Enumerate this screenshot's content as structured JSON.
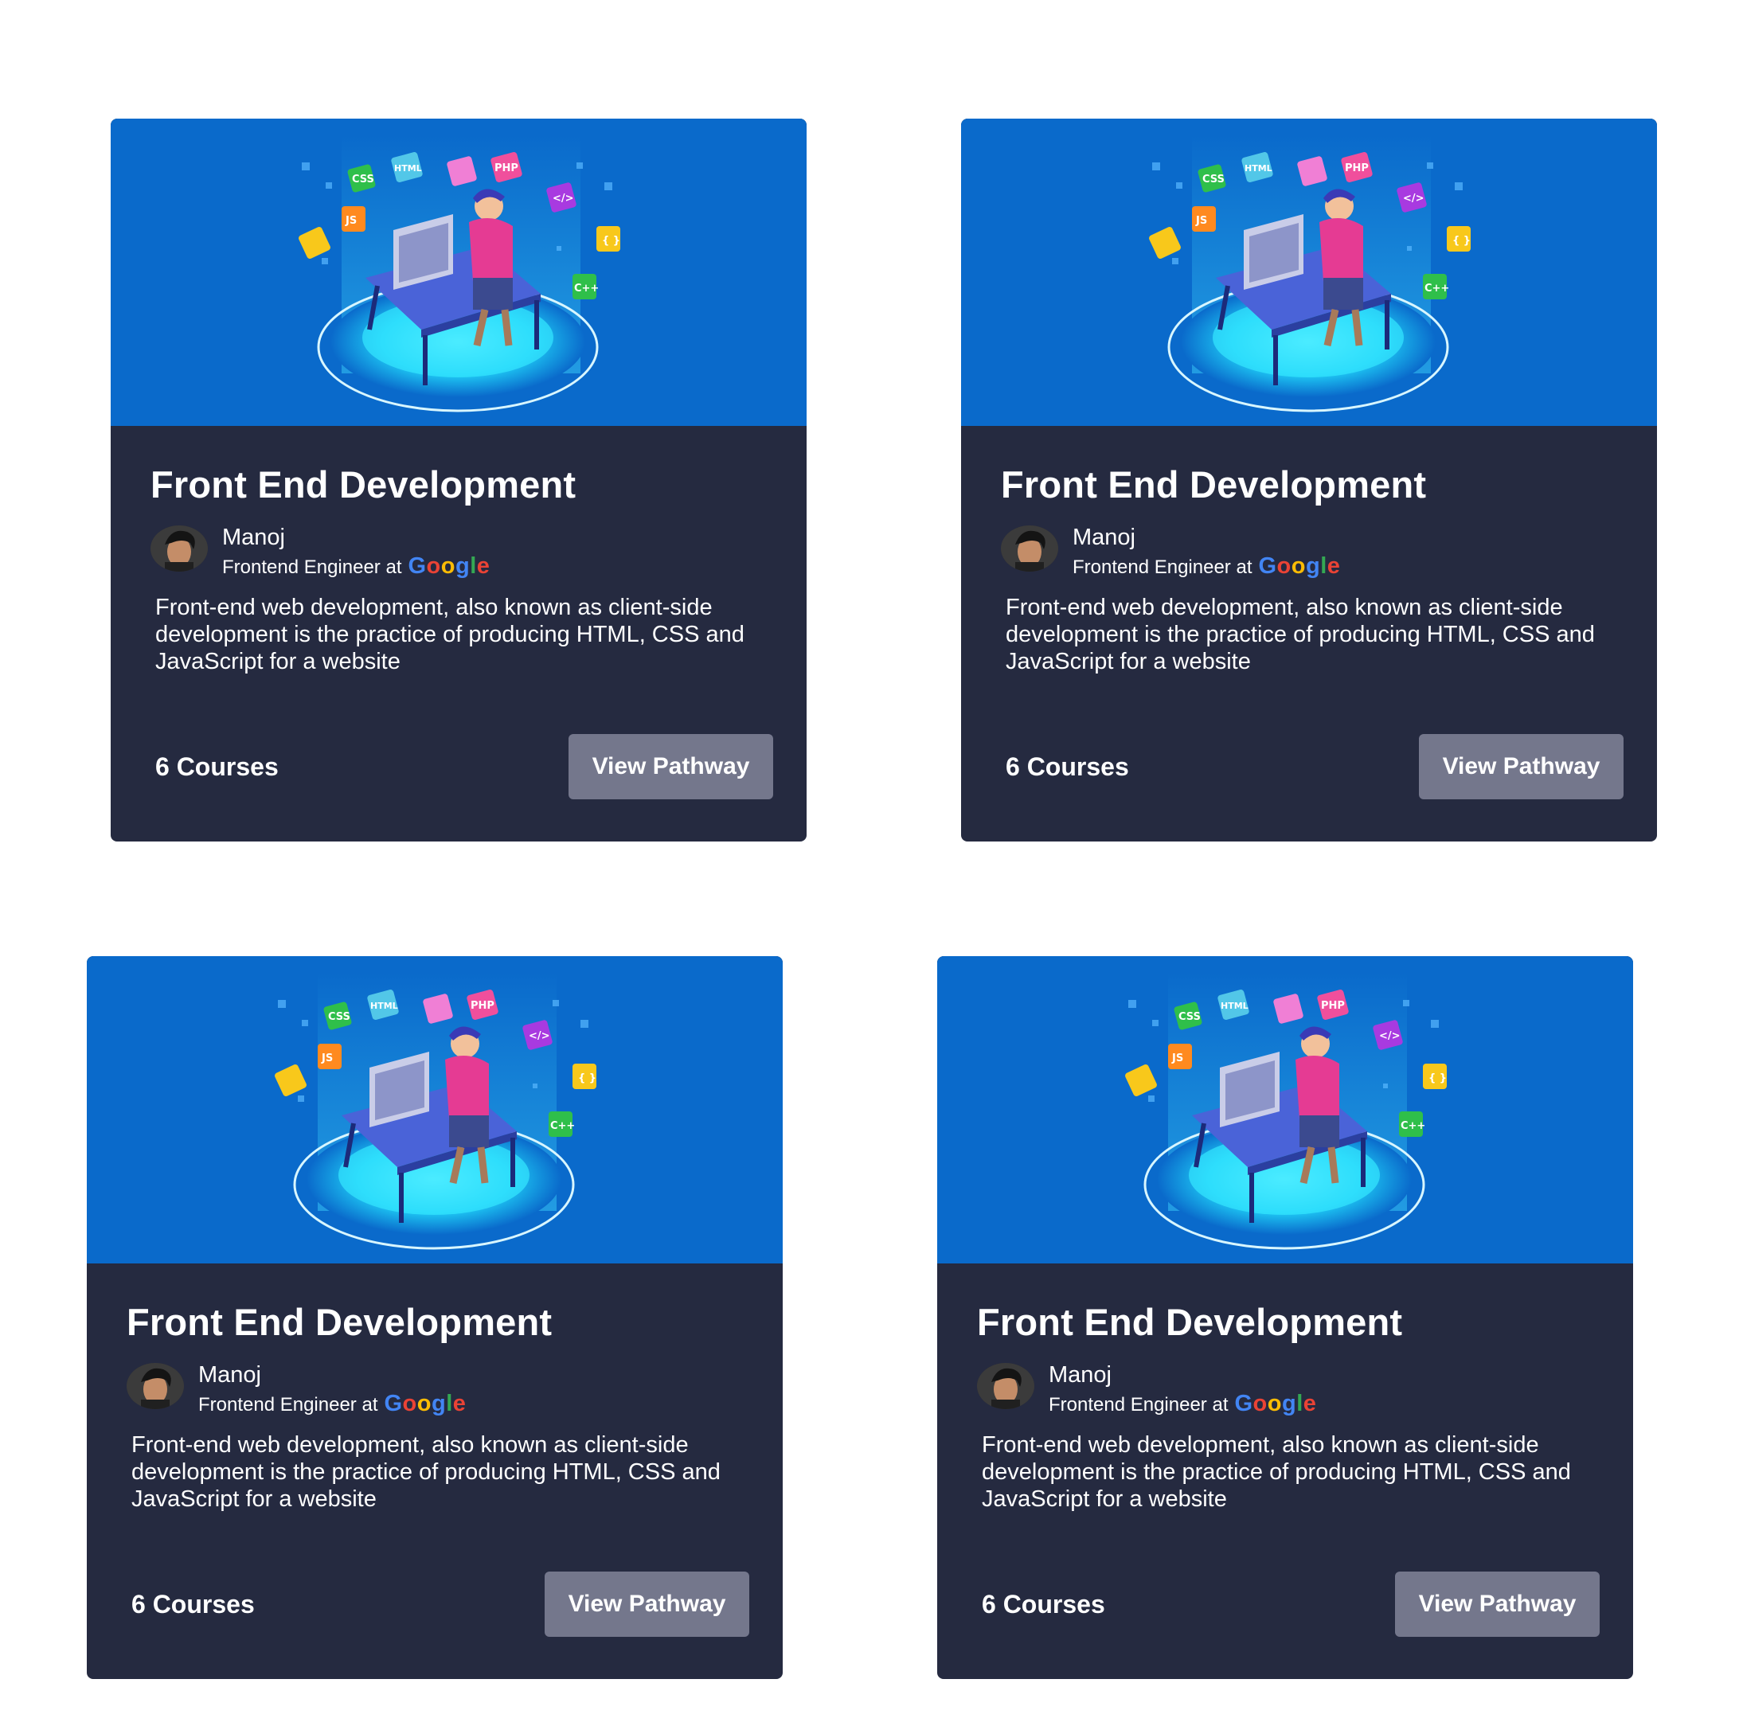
{
  "cards": [
    {
      "title": "Front End Development",
      "author": {
        "name": "Manoj",
        "role": "Frontend Engineer at",
        "company_letters": [
          "G",
          "o",
          "o",
          "g",
          "l",
          "e"
        ]
      },
      "description": "Front-end web development, also known as client-side development is the practice of producing HTML, CSS and JavaScript for a website",
      "courses_label": "6 Courses",
      "button_label": "View Pathway",
      "hero_icons": [
        "CSS",
        "HTML",
        "PHP",
        "JS",
        "C++",
        "</>",
        "{}"
      ]
    },
    {
      "title": "Front End Development",
      "author": {
        "name": "Manoj",
        "role": "Frontend Engineer at",
        "company_letters": [
          "G",
          "o",
          "o",
          "g",
          "l",
          "e"
        ]
      },
      "description": "Front-end web development, also known as client-side development is the practice of producing HTML, CSS and JavaScript for a website",
      "courses_label": "6 Courses",
      "button_label": "View Pathway",
      "hero_icons": [
        "CSS",
        "HTML",
        "PHP",
        "JS",
        "C++",
        "</>",
        "{}"
      ]
    },
    {
      "title": "Front End Development",
      "author": {
        "name": "Manoj",
        "role": "Frontend Engineer at",
        "company_letters": [
          "G",
          "o",
          "o",
          "g",
          "l",
          "e"
        ]
      },
      "description": "Front-end web development, also known as client-side development is the practice of producing HTML, CSS and JavaScript for a website",
      "courses_label": "6 Courses",
      "button_label": "View Pathway",
      "hero_icons": [
        "CSS",
        "HTML",
        "PHP",
        "JS",
        "C++",
        "</>",
        "{}"
      ]
    },
    {
      "title": "Front End Development",
      "author": {
        "name": "Manoj",
        "role": "Frontend Engineer at",
        "company_letters": [
          "G",
          "o",
          "o",
          "g",
          "l",
          "e"
        ]
      },
      "description": "Front-end web development, also known as client-side development is the practice of producing HTML, CSS and JavaScript for a website",
      "courses_label": "6 Courses",
      "button_label": "View Pathway",
      "hero_icons": [
        "CSS",
        "HTML",
        "PHP",
        "JS",
        "C++",
        "</>",
        "{}"
      ]
    }
  ],
  "colors": {
    "card_background": "#252a40",
    "hero_background": "#0a6acb",
    "button_background": "#74778c",
    "page_background": "#ffffff"
  }
}
